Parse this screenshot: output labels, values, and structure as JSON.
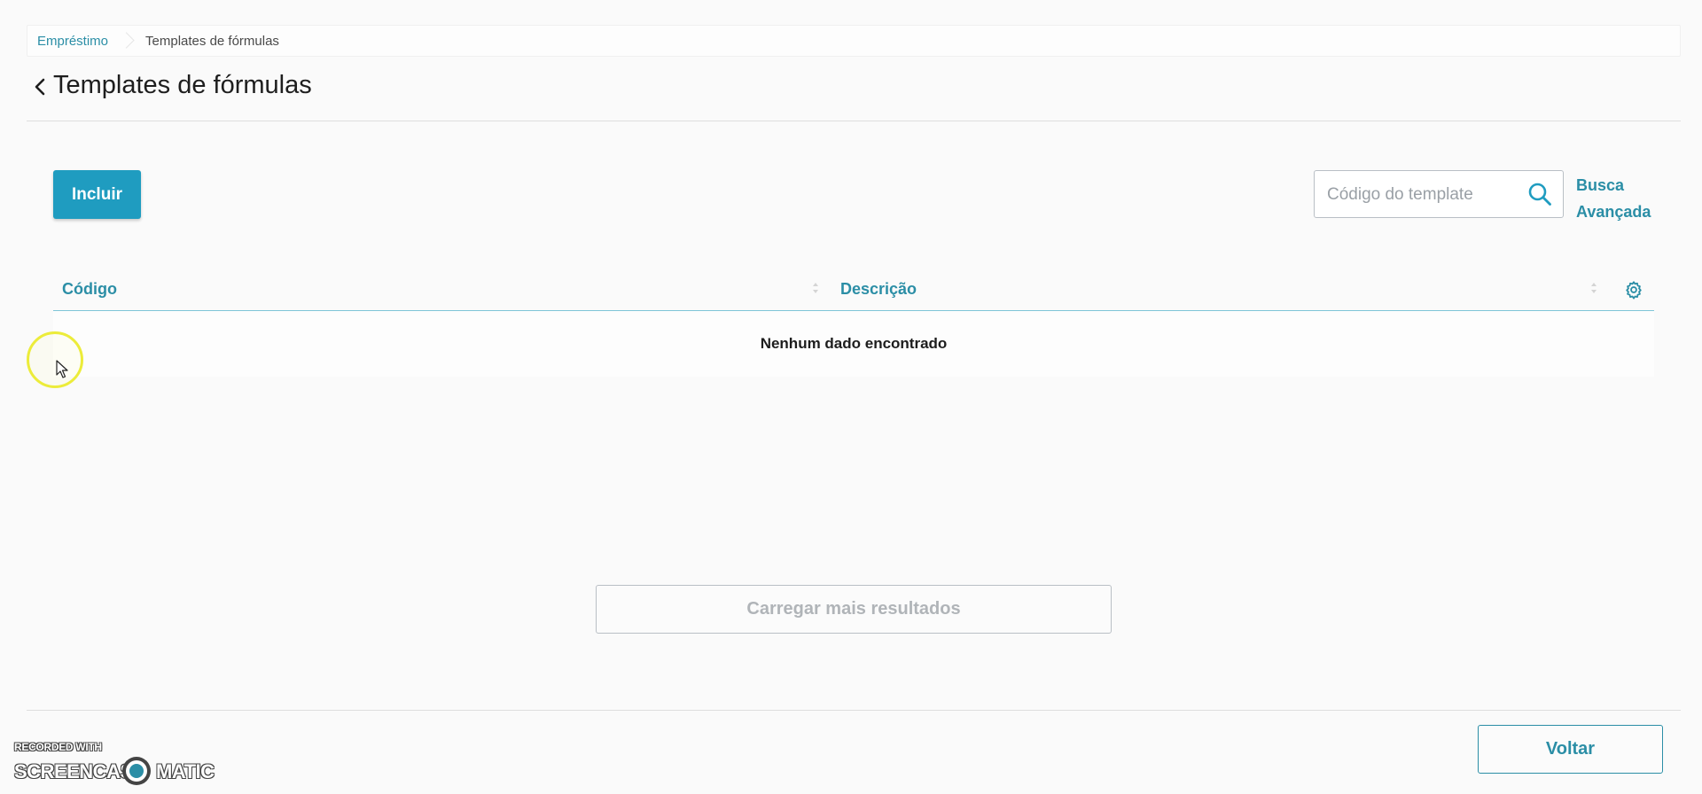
{
  "breadcrumb": {
    "items": [
      {
        "label": "Empréstimo"
      },
      {
        "label": "Templates de fórmulas"
      }
    ]
  },
  "page": {
    "title": "Templates de fórmulas"
  },
  "actions": {
    "include_label": "Incluir"
  },
  "search": {
    "placeholder": "Código do template",
    "value": "",
    "advanced_line1": "Busca",
    "advanced_line2": "Avançada"
  },
  "table": {
    "columns": [
      {
        "label": "Código"
      },
      {
        "label": "Descrição"
      }
    ],
    "empty_message": "Nenhum dado encontrado"
  },
  "load_more_label": "Carregar mais resultados",
  "footer": {
    "back_label": "Voltar"
  },
  "watermark": {
    "line1": "RECORDED WITH",
    "part1": "SCREENCAST",
    "part2": "MATIC"
  },
  "colors": {
    "primary": "#1f9cc0",
    "link": "#2b8ea6",
    "disabled_text": "#b0b4b8",
    "background": "#fafafa"
  }
}
